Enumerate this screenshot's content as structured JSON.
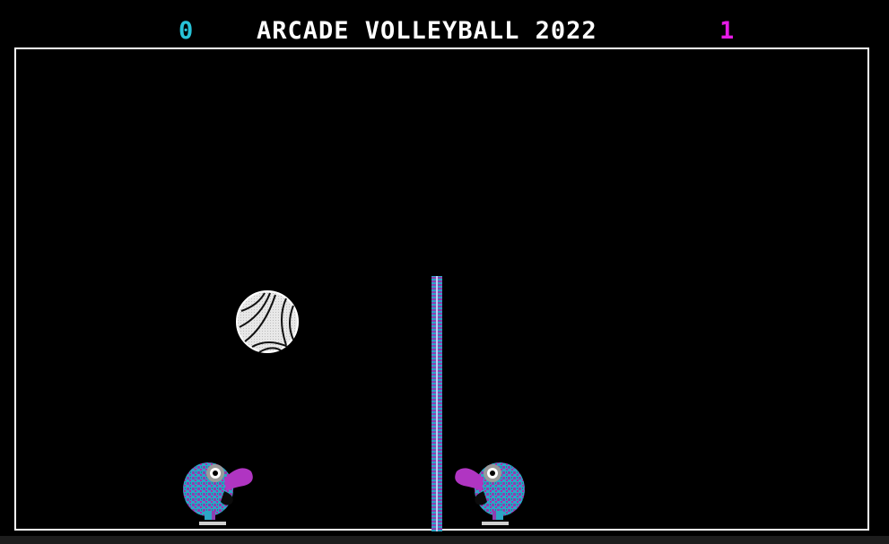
{
  "hud": {
    "title": "ARCADE VOLLEYBALL 2022",
    "score_left": "0",
    "score_right": "1"
  },
  "colors": {
    "left_score": "#27c3d8",
    "right_score": "#e61ae6",
    "court_border": "#ffffff",
    "background": "#000000",
    "player_cyan": "#2ca6c6",
    "player_purple": "#8f3fb0",
    "ball": "#e8e8e8"
  },
  "sprites": {
    "ball": "volleyball-icon",
    "left_player": "bird-player-icon",
    "right_player": "bird-player-icon",
    "net": "net-pole-icon"
  }
}
